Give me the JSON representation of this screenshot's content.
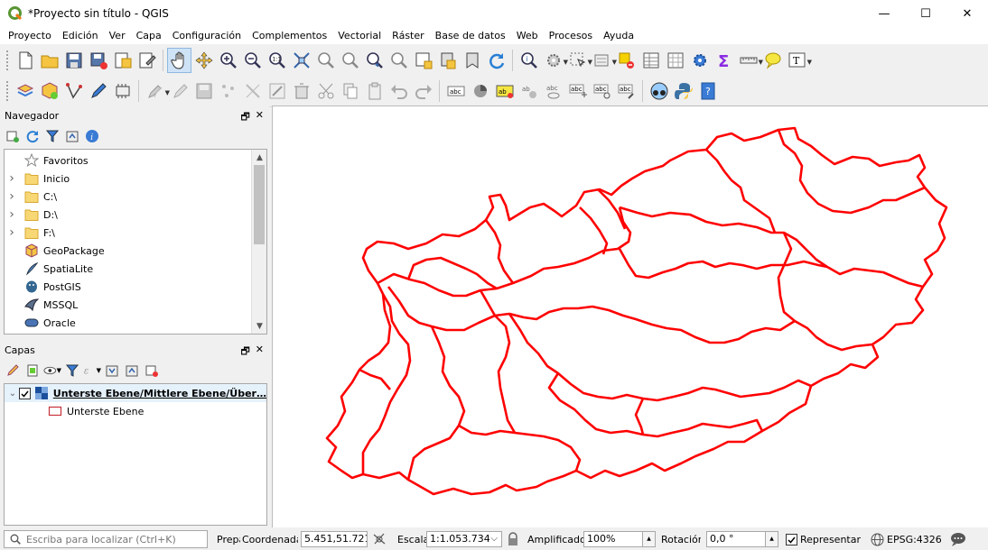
{
  "window": {
    "title": "*Proyecto sin título - QGIS",
    "minimize": "—",
    "maximize": "☐",
    "close": "✕"
  },
  "menu": [
    "Proyecto",
    "Edición",
    "Ver",
    "Capa",
    "Configuración",
    "Complementos",
    "Vectorial",
    "Ráster",
    "Base de datos",
    "Web",
    "Procesos",
    "Ayuda"
  ],
  "browser_panel": {
    "title": "Navegador",
    "items": [
      {
        "label": "Favoritos",
        "icon": "star-icon",
        "expand": false
      },
      {
        "label": "Inicio",
        "icon": "folder-icon",
        "expand": true
      },
      {
        "label": "C:\\",
        "icon": "folder-icon",
        "expand": true
      },
      {
        "label": "D:\\",
        "icon": "folder-icon",
        "expand": true
      },
      {
        "label": "F:\\",
        "icon": "folder-icon",
        "expand": true
      },
      {
        "label": "GeoPackage",
        "icon": "geopackage-icon",
        "expand": false
      },
      {
        "label": "SpatiaLite",
        "icon": "spatialite-icon",
        "expand": false
      },
      {
        "label": "PostGIS",
        "icon": "postgis-icon",
        "expand": false
      },
      {
        "label": "MSSQL",
        "icon": "mssql-icon",
        "expand": false
      },
      {
        "label": "Oracle",
        "icon": "oracle-icon",
        "expand": false
      }
    ]
  },
  "layers_panel": {
    "title": "Capas",
    "group_label": "Unterste Ebene/Mittlere Ebene/Über…",
    "layer_label": "Unterste Ebene",
    "layer_color": "#c8323c"
  },
  "map": {
    "stroke_color": "#ff0000"
  },
  "statusbar": {
    "locator_placeholder": "Escriba para localizar (Ctrl+K)",
    "ready_label": "Prepa",
    "coord_label": "Coordenada",
    "coord_value": "5.451,51.721",
    "scale_label": "Escala",
    "scale_value": "1:1.053.734",
    "magnifier_label": "Amplificador",
    "magnifier_value": "100%",
    "rotation_label": "Rotación",
    "rotation_value": "0,0 °",
    "render_label": "Representar",
    "crs_label": "EPSG:4326"
  }
}
